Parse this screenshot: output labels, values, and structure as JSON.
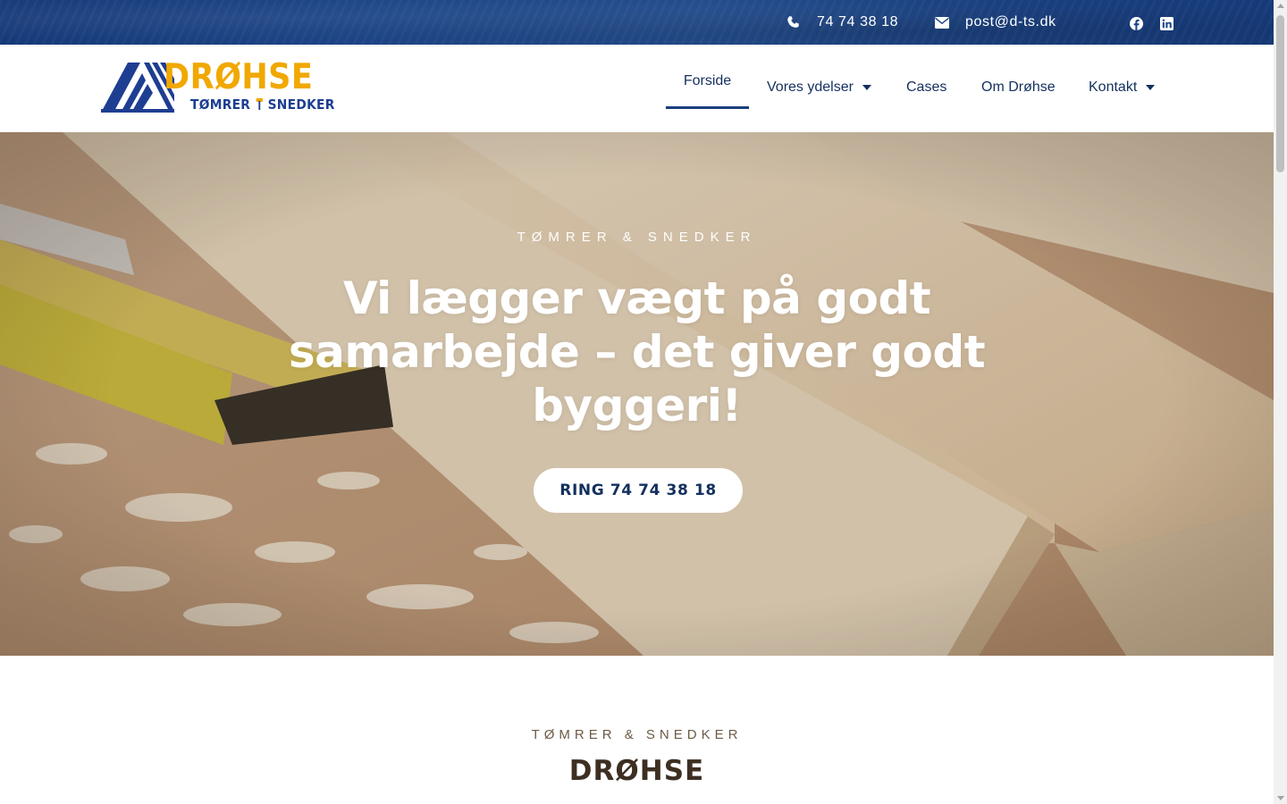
{
  "topbar": {
    "phone": "74 74 38 18",
    "email": "post@d-ts.dk",
    "icons": {
      "phone": "phone-icon",
      "email": "envelope-icon",
      "facebook": "facebook-icon",
      "linkedin": "linkedin-icon"
    }
  },
  "logo": {
    "word": "DRØHSE",
    "sub_left": "TØMRER",
    "sub_right": "SNEDKER"
  },
  "nav": {
    "items": [
      {
        "label": "Forside",
        "active": true
      },
      {
        "label": "Vores ydelser",
        "dropdown": true
      },
      {
        "label": "Cases"
      },
      {
        "label": "Om Drøhse"
      },
      {
        "label": "Kontakt",
        "dropdown": true
      }
    ]
  },
  "hero": {
    "eyebrow": "TØMRER & SNEDKER",
    "title": "Vi lægger vægt på godt samarbejde – det giver godt byggeri!",
    "button": "RING 74 74 38 18"
  },
  "section": {
    "eyebrow": "TØMRER & SNEDKER",
    "title": "DRØHSE"
  },
  "colors": {
    "brand_blue": "#1a3f7d",
    "brand_yellow": "#f1a800",
    "nav_text": "#14305f",
    "section_brown": "#3d2f22"
  }
}
